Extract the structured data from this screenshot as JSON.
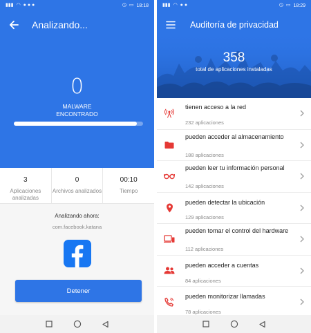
{
  "left": {
    "status": {
      "time": "18:18"
    },
    "title": "Analizando...",
    "malware_count": "0",
    "malware_label": "MALWARE ENCONTRADO",
    "progress": 0.95,
    "stats": [
      {
        "value": "3",
        "label": "Aplicaciones analizadas"
      },
      {
        "value": "0",
        "label": "Archivos analizados"
      },
      {
        "value": "00:10",
        "label": "Tiempo"
      }
    ],
    "analyzing_now_label": "Analizando ahora:",
    "package": "com.facebook.katana",
    "app_icon": "facebook-icon",
    "stop_label": "Detener"
  },
  "right": {
    "status": {
      "time": "18:29"
    },
    "title": "Auditoría de privacidad",
    "total_count": "358",
    "total_label": "total de aplicaciones instaladas",
    "items": [
      {
        "title": "tienen acceso a la red",
        "count": "232 aplicaciones",
        "icon": "antenna-icon"
      },
      {
        "title": "pueden acceder al almacenamiento",
        "count": "188 aplicaciones",
        "icon": "folder-icon"
      },
      {
        "title": "pueden leer tu información personal",
        "count": "142 aplicaciones",
        "icon": "glasses-icon"
      },
      {
        "title": "pueden detectar la ubicación",
        "count": "129 aplicaciones",
        "icon": "location-pin-icon"
      },
      {
        "title": "pueden tomar el control del hardware",
        "count": "112 aplicaciones",
        "icon": "devices-icon"
      },
      {
        "title": "pueden acceder a cuentas",
        "count": "84 aplicaciones",
        "icon": "people-icon"
      },
      {
        "title": "pueden monitorizar llamadas",
        "count": "78 aplicaciones",
        "icon": "phone-call-icon"
      }
    ]
  },
  "colors": {
    "primary_blue": "#2e75e6",
    "icon_red": "#e53935",
    "facebook_blue": "#1877f2"
  }
}
